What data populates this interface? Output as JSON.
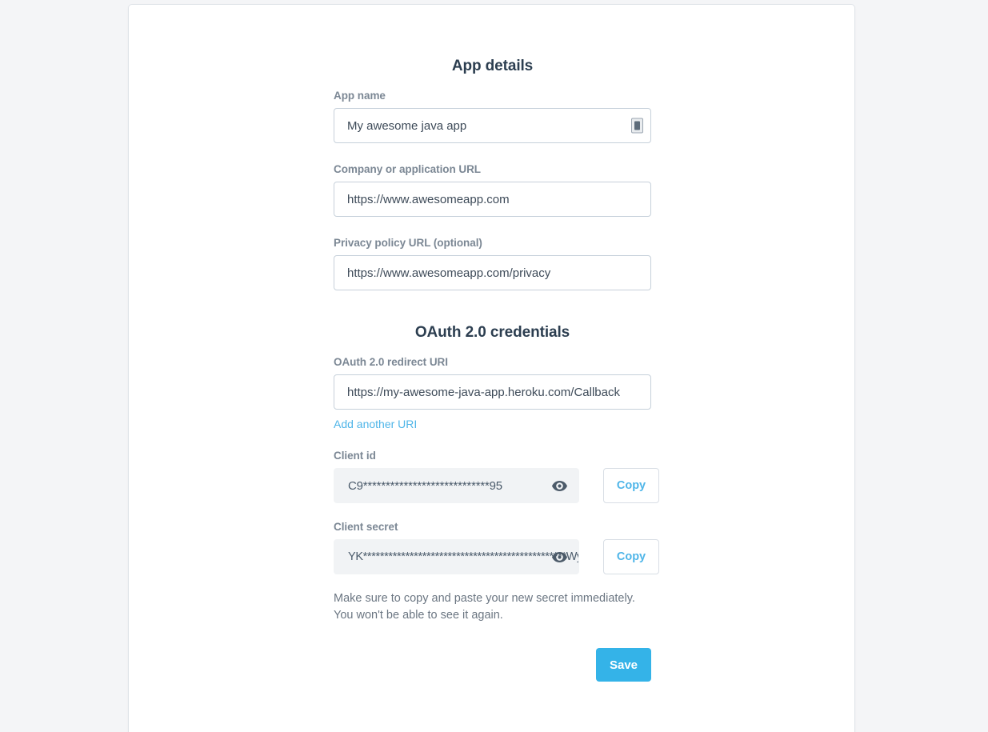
{
  "sections": {
    "app_details": {
      "title": "App details",
      "fields": [
        {
          "label": "App name",
          "value": "My awesome java app",
          "placeholder": "App name",
          "icon": "autofill-contact-card-icon"
        },
        {
          "label": "Company or application URL",
          "value": "https://www.awesomeapp.com",
          "placeholder": "https://"
        },
        {
          "label": "Privacy policy URL (optional)",
          "value": "https://www.awesomeapp.com/privacy",
          "placeholder": "https://"
        }
      ]
    },
    "oauth": {
      "title": "OAuth 2.0 credentials",
      "redirect": {
        "label": "OAuth 2.0 redirect URI",
        "value": "https://my-awesome-java-app.heroku.com/Callback",
        "placeholder": "https://"
      },
      "add_another_link": "Add another URI",
      "client_id": {
        "label": "Client id",
        "value": "C9****************************95",
        "reveal_icon": "eye-icon",
        "copy_label": "Copy"
      },
      "client_secret": {
        "label": "Client secret",
        "value": "YK************************************************Wy",
        "reveal_icon": "eye-icon",
        "copy_label": "Copy"
      },
      "note_line1": "Make sure to copy and paste your new secret immediately.",
      "note_line2": "You won't be able to see it again."
    }
  },
  "actions": {
    "save_label": "Save"
  },
  "colors": {
    "accent": "#34b3e8",
    "link": "#4fb5e8",
    "heading": "#2c3e50",
    "label": "#7b8794",
    "page_bg": "#f4f5f7",
    "card_bg": "#ffffff",
    "input_border": "#c6d0da",
    "credential_bg": "#f1f3f5"
  }
}
